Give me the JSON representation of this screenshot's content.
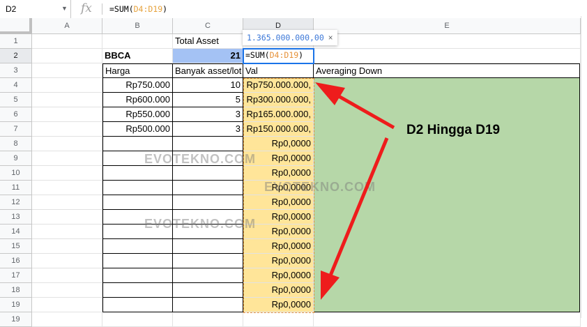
{
  "formula_bar": {
    "name_box": "D2",
    "fx_label": "fx",
    "formula_prefix": "=SUM(",
    "formula_ref": "D4:D19",
    "formula_suffix": ")"
  },
  "columns": [
    "A",
    "B",
    "C",
    "D",
    "E"
  ],
  "rows": [
    "1",
    "2",
    "3",
    "4",
    "5",
    "6",
    "7",
    "8",
    "9",
    "10",
    "11",
    "12",
    "13",
    "14",
    "15",
    "16",
    "17",
    "18",
    "19",
    "19"
  ],
  "cells": {
    "c1": "Total Asset",
    "b2": "BBCA",
    "c2": "21",
    "b3": "Harga",
    "c3": "Banyak asset/lot",
    "d3": "Val",
    "e3": "Averaging Down",
    "b4": "Rp750.000",
    "c4": "10",
    "d4": "Rp750.000.000,",
    "b5": "Rp600.000",
    "c5": "5",
    "d5": "Rp300.000.000,",
    "b6": "Rp550.000",
    "c6": "3",
    "d6": "Rp165.000.000,",
    "b7": "Rp500.000",
    "c7": "3",
    "d7": "Rp150.000.000,",
    "d_zero": "Rp0,0000"
  },
  "active_cell": {
    "prefix": "=SUM(",
    "ref": "D4:D19",
    "suffix": ")"
  },
  "tooltip": {
    "value": "1.365.000.000,00",
    "close": "×"
  },
  "watermark": "EVOTEKNO.COM",
  "annotation": "D2 Hingga D19",
  "colors": {
    "green_fill": "#b6d7a8",
    "yellow_fill": "#ffe599",
    "blue_fill": "#a4c2f4",
    "arrow": "#ee1c1c",
    "selection": "#1a73e8"
  }
}
